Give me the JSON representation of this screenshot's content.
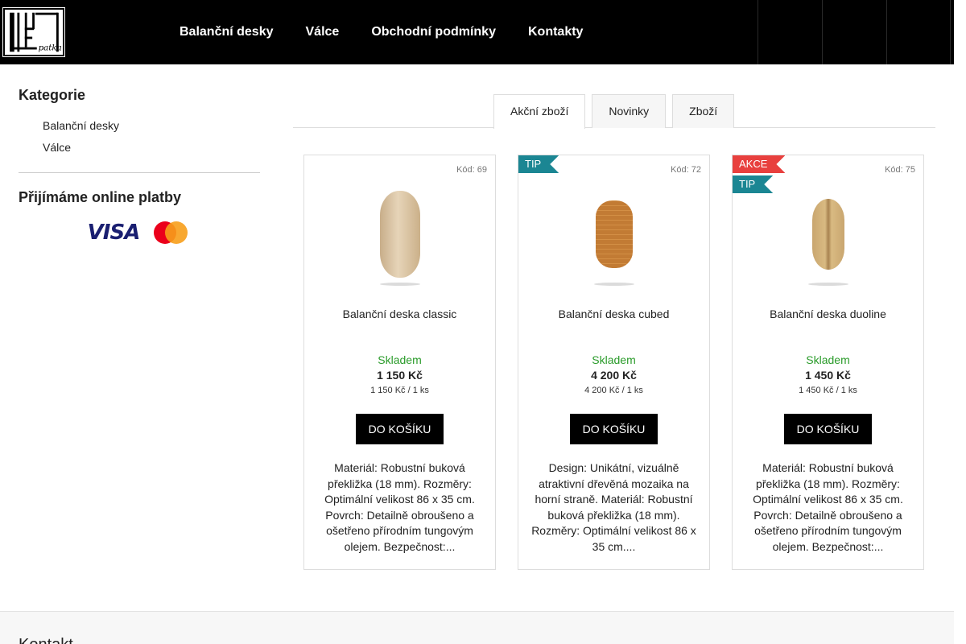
{
  "header": {
    "logo_text": "patka",
    "nav": [
      "Balanční desky",
      "Válce",
      "Obchodní podmínky",
      "Kontakty"
    ]
  },
  "sidebar": {
    "categories_title": "Kategorie",
    "categories": [
      "Balanční desky",
      "Válce"
    ],
    "payments_title": "Přijímáme online platby",
    "visa_text": "VISA"
  },
  "tabs": [
    "Akční zboží",
    "Novinky",
    "Zboží"
  ],
  "products": [
    {
      "code": "Kód: 69",
      "flags": [],
      "name": "Balanční deska classic",
      "stock": "Skladem",
      "price": "1 150 Kč",
      "unit_price": "1 150 Kč / 1 ks",
      "buy_label": "DO KOŠÍKU",
      "description": "Materiál: Robustní buková překližka (18 mm). Rozměry: Optimální velikost 86 x 35 cm. Povrch: Detailně obroušeno a ošetřeno přírodním tungovým olejem. Bezpečnost:..."
    },
    {
      "code": "Kód: 72",
      "flags": [
        "TIP"
      ],
      "name": "Balanční deska cubed",
      "stock": "Skladem",
      "price": "4 200 Kč",
      "unit_price": "4 200 Kč / 1 ks",
      "buy_label": "DO KOŠÍKU",
      "description": "Design: Unikátní, vizuálně atraktivní dřevěná mozaika na horní straně. Materiál: Robustní buková překližka (18 mm). Rozměry: Optimální velikost 86 x 35 cm...."
    },
    {
      "code": "Kód: 75",
      "flags": [
        "AKCE",
        "TIP"
      ],
      "name": "Balanční deska duoline",
      "stock": "Skladem",
      "price": "1 450 Kč",
      "unit_price": "1 450 Kč / 1 ks",
      "buy_label": "DO KOŠÍKU",
      "description": "Materiál: Robustní buková překližka (18 mm). Rozměry: Optimální velikost 86 x 35 cm. Povrch: Detailně obroušeno a ošetřeno přírodním tungovým olejem. Bezpečnost:..."
    }
  ],
  "footer": {
    "title": "Kontakt"
  },
  "colors": {
    "header_bg": "#000000",
    "stock_green": "#2a9b2a",
    "tip_flag": "#1b8693",
    "akce_flag": "#e8403e"
  }
}
